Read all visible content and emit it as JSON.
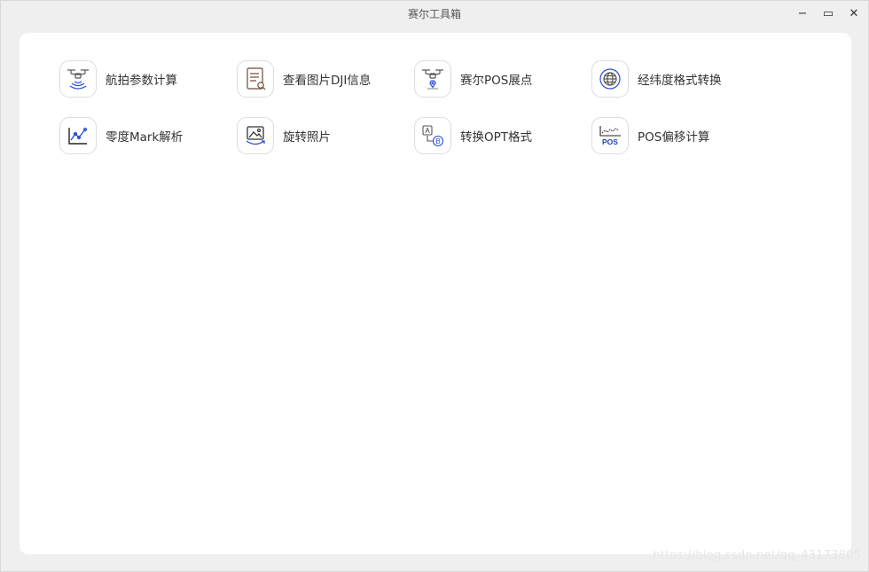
{
  "window": {
    "title": "赛尔工具箱",
    "controls": {
      "minimize": "−",
      "maximize": "▭",
      "close": "✕"
    }
  },
  "tools": [
    {
      "label": "航拍参数计算",
      "icon": "drone-signal-icon"
    },
    {
      "label": "查看图片DJI信息",
      "icon": "document-search-icon"
    },
    {
      "label": "赛尔POS展点",
      "icon": "drone-pin-icon"
    },
    {
      "label": "经纬度格式转换",
      "icon": "globe-icon"
    },
    {
      "label": "零度Mark解析",
      "icon": "line-chart-icon"
    },
    {
      "label": "旋转照片",
      "icon": "rotate-image-icon"
    },
    {
      "label": "转换OPT格式",
      "icon": "a-to-b-icon"
    },
    {
      "label": "POS偏移计算",
      "icon": "pos-offset-icon"
    }
  ],
  "pos_icon_text": "POS",
  "ab_icon_text": {
    "a": "A",
    "b": "B"
  },
  "watermark": "https://blog.csdn.net/qq_43173805",
  "colors": {
    "accent": "#2a4fd6",
    "icon_stroke": "#555555",
    "background": "#efefef"
  }
}
